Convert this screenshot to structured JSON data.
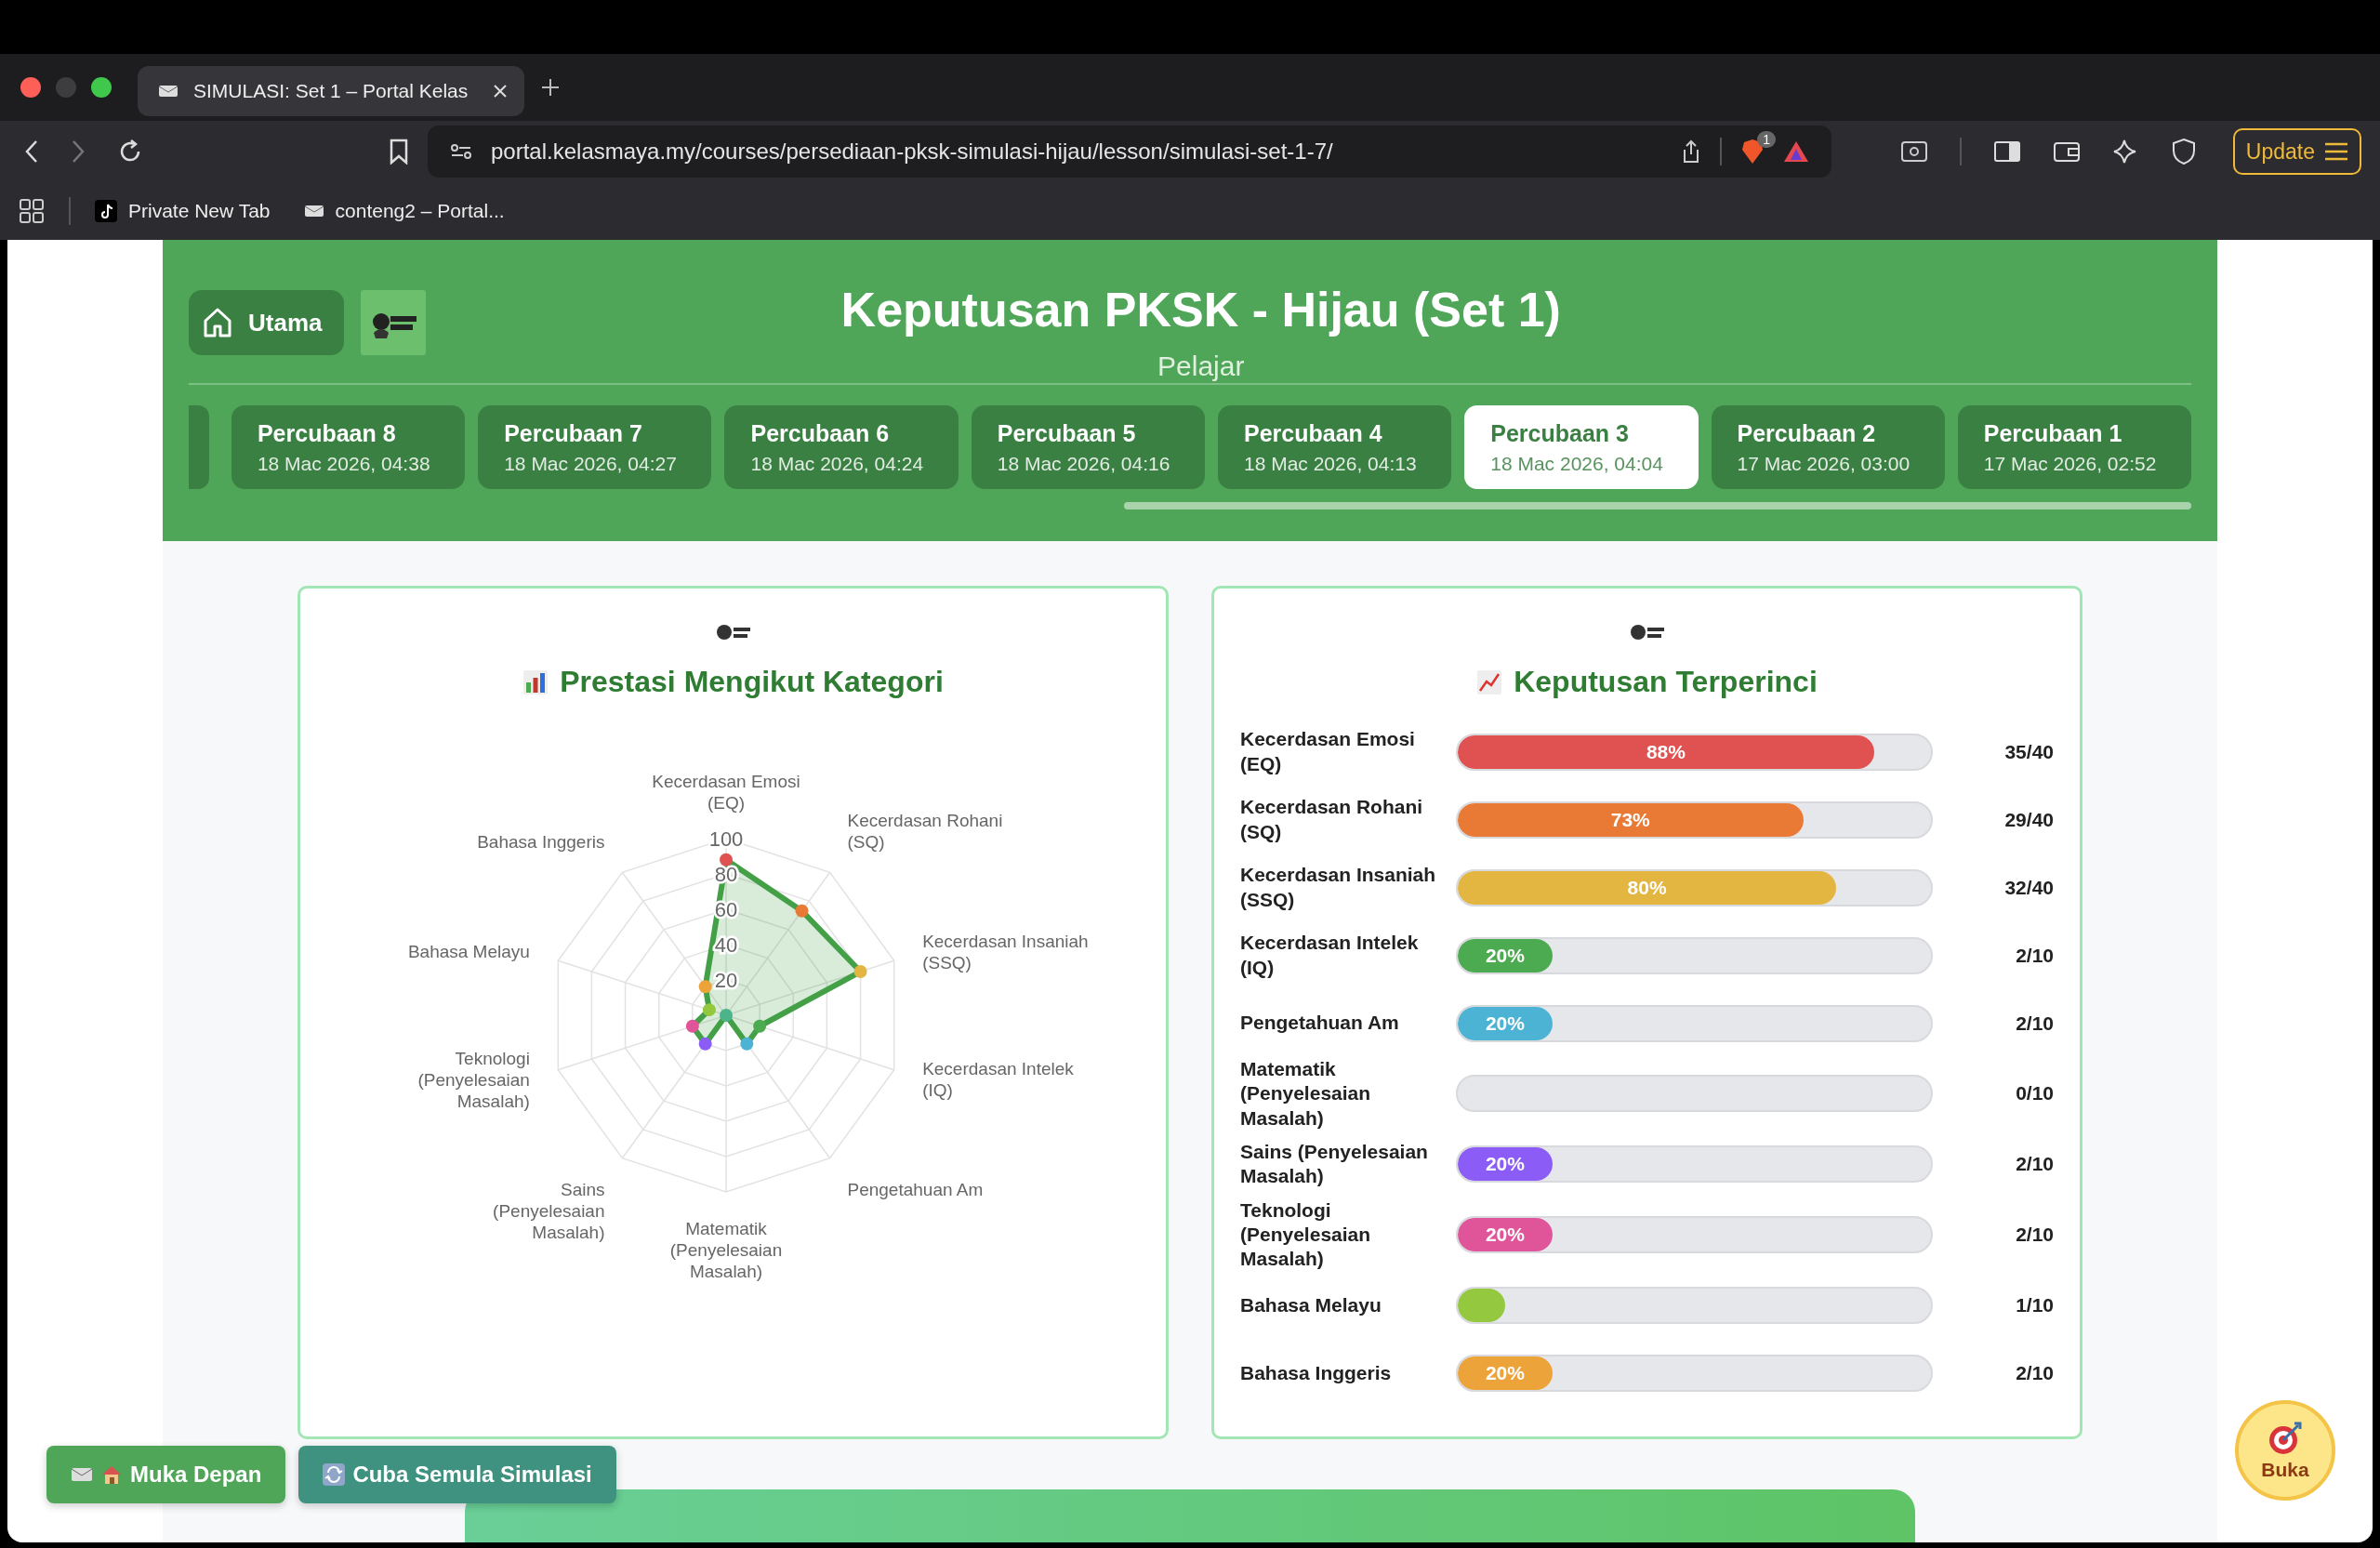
{
  "browser": {
    "tab_title": "SIMULASI: Set 1 – Portal Kelas",
    "url": "portal.kelasmaya.my/courses/persediaan-pksk-simulasi-hijau/lesson/simulasi-set-1-7/",
    "shield_badge": "1",
    "update_button": "Update",
    "bookmarks": [
      "Private New Tab",
      "conteng2 – Portal..."
    ]
  },
  "header": {
    "home_button": "Utama",
    "title": "Keputusan PKSK - Hijau (Set 1)",
    "subtitle": "Pelajar"
  },
  "attempts": [
    {
      "name": "Percubaan 8",
      "time": "18 Mac 2026, 04:38",
      "selected": false
    },
    {
      "name": "Percubaan 7",
      "time": "18 Mac 2026, 04:27",
      "selected": false
    },
    {
      "name": "Percubaan 6",
      "time": "18 Mac 2026, 04:24",
      "selected": false
    },
    {
      "name": "Percubaan 5",
      "time": "18 Mac 2026, 04:16",
      "selected": false
    },
    {
      "name": "Percubaan 4",
      "time": "18 Mac 2026, 04:13",
      "selected": false
    },
    {
      "name": "Percubaan 3",
      "time": "18 Mac 2026, 04:04",
      "selected": true
    },
    {
      "name": "Percubaan 2",
      "time": "17 Mac 2026, 03:00",
      "selected": false
    },
    {
      "name": "Percubaan 1",
      "time": "17 Mac 2026, 02:52",
      "selected": false
    }
  ],
  "category_panel": {
    "title": "Prestasi Mengikut Kategori",
    "chart_data": {
      "type": "radar",
      "categories": [
        "Kecerdasan Emosi (EQ)",
        "Kecerdasan Rohani (SQ)",
        "Kecerdasan Insaniah (SSQ)",
        "Kecerdasan Intelek (IQ)",
        "Pengetahuan Am",
        "Matematik (Penyelesaian Masalah)",
        "Sains (Penyelesaian Masalah)",
        "Teknologi (Penyelesaian Masalah)",
        "Bahasa Melayu",
        "Bahasa Inggeris"
      ],
      "series": [
        {
          "color": "#43a047",
          "values": [
            88,
            73,
            80,
            20,
            20,
            0,
            20,
            20,
            10,
            20
          ]
        }
      ],
      "ylim": [
        0,
        100
      ],
      "yticks": [
        20,
        40,
        60,
        80,
        100
      ]
    }
  },
  "detail_panel": {
    "title": "Keputusan Terperinci",
    "rows": [
      {
        "name": "Kecerdasan Emosi (EQ)",
        "percent": "88%",
        "level": 0.88,
        "score": "35/40",
        "color": "#e05252"
      },
      {
        "name": "Kecerdasan Rohani (SQ)",
        "percent": "73%",
        "level": 0.73,
        "score": "29/40",
        "color": "#e87a35"
      },
      {
        "name": "Kecerdasan Insaniah (SSQ)",
        "percent": "80%",
        "level": 0.8,
        "score": "32/40",
        "color": "#e3b541"
      },
      {
        "name": "Kecerdasan Intelek (IQ)",
        "percent": "20%",
        "level": 0.2,
        "score": "2/10",
        "color": "#4caa50"
      },
      {
        "name": "Pengetahuan Am",
        "percent": "20%",
        "level": 0.2,
        "score": "2/10",
        "color": "#4db3d4"
      },
      {
        "name": "Matematik (Penyelesaian Masalah)",
        "level": 0,
        "score": "0/10",
        "color": "#4cb38a"
      },
      {
        "name": "Sains (Penyelesaian Masalah)",
        "percent": "20%",
        "level": 0.2,
        "score": "2/10",
        "color": "#8b5cf6"
      },
      {
        "name": "Teknologi (Penyelesaian Masalah)",
        "percent": "20%",
        "level": 0.2,
        "score": "2/10",
        "color": "#e0559a"
      },
      {
        "name": "Bahasa Melayu",
        "level": 0.1,
        "score": "1/10",
        "color": "#93c83f"
      },
      {
        "name": "Bahasa Inggeris",
        "percent": "20%",
        "level": 0.2,
        "score": "2/10",
        "color": "#eba33a"
      }
    ]
  },
  "footer_buttons": [
    {
      "label": "Muka Depan",
      "kind": "home"
    },
    {
      "label": "Cuba Semula Simulasi",
      "kind": "retry"
    }
  ],
  "floating_button": {
    "label": "Buka"
  }
}
